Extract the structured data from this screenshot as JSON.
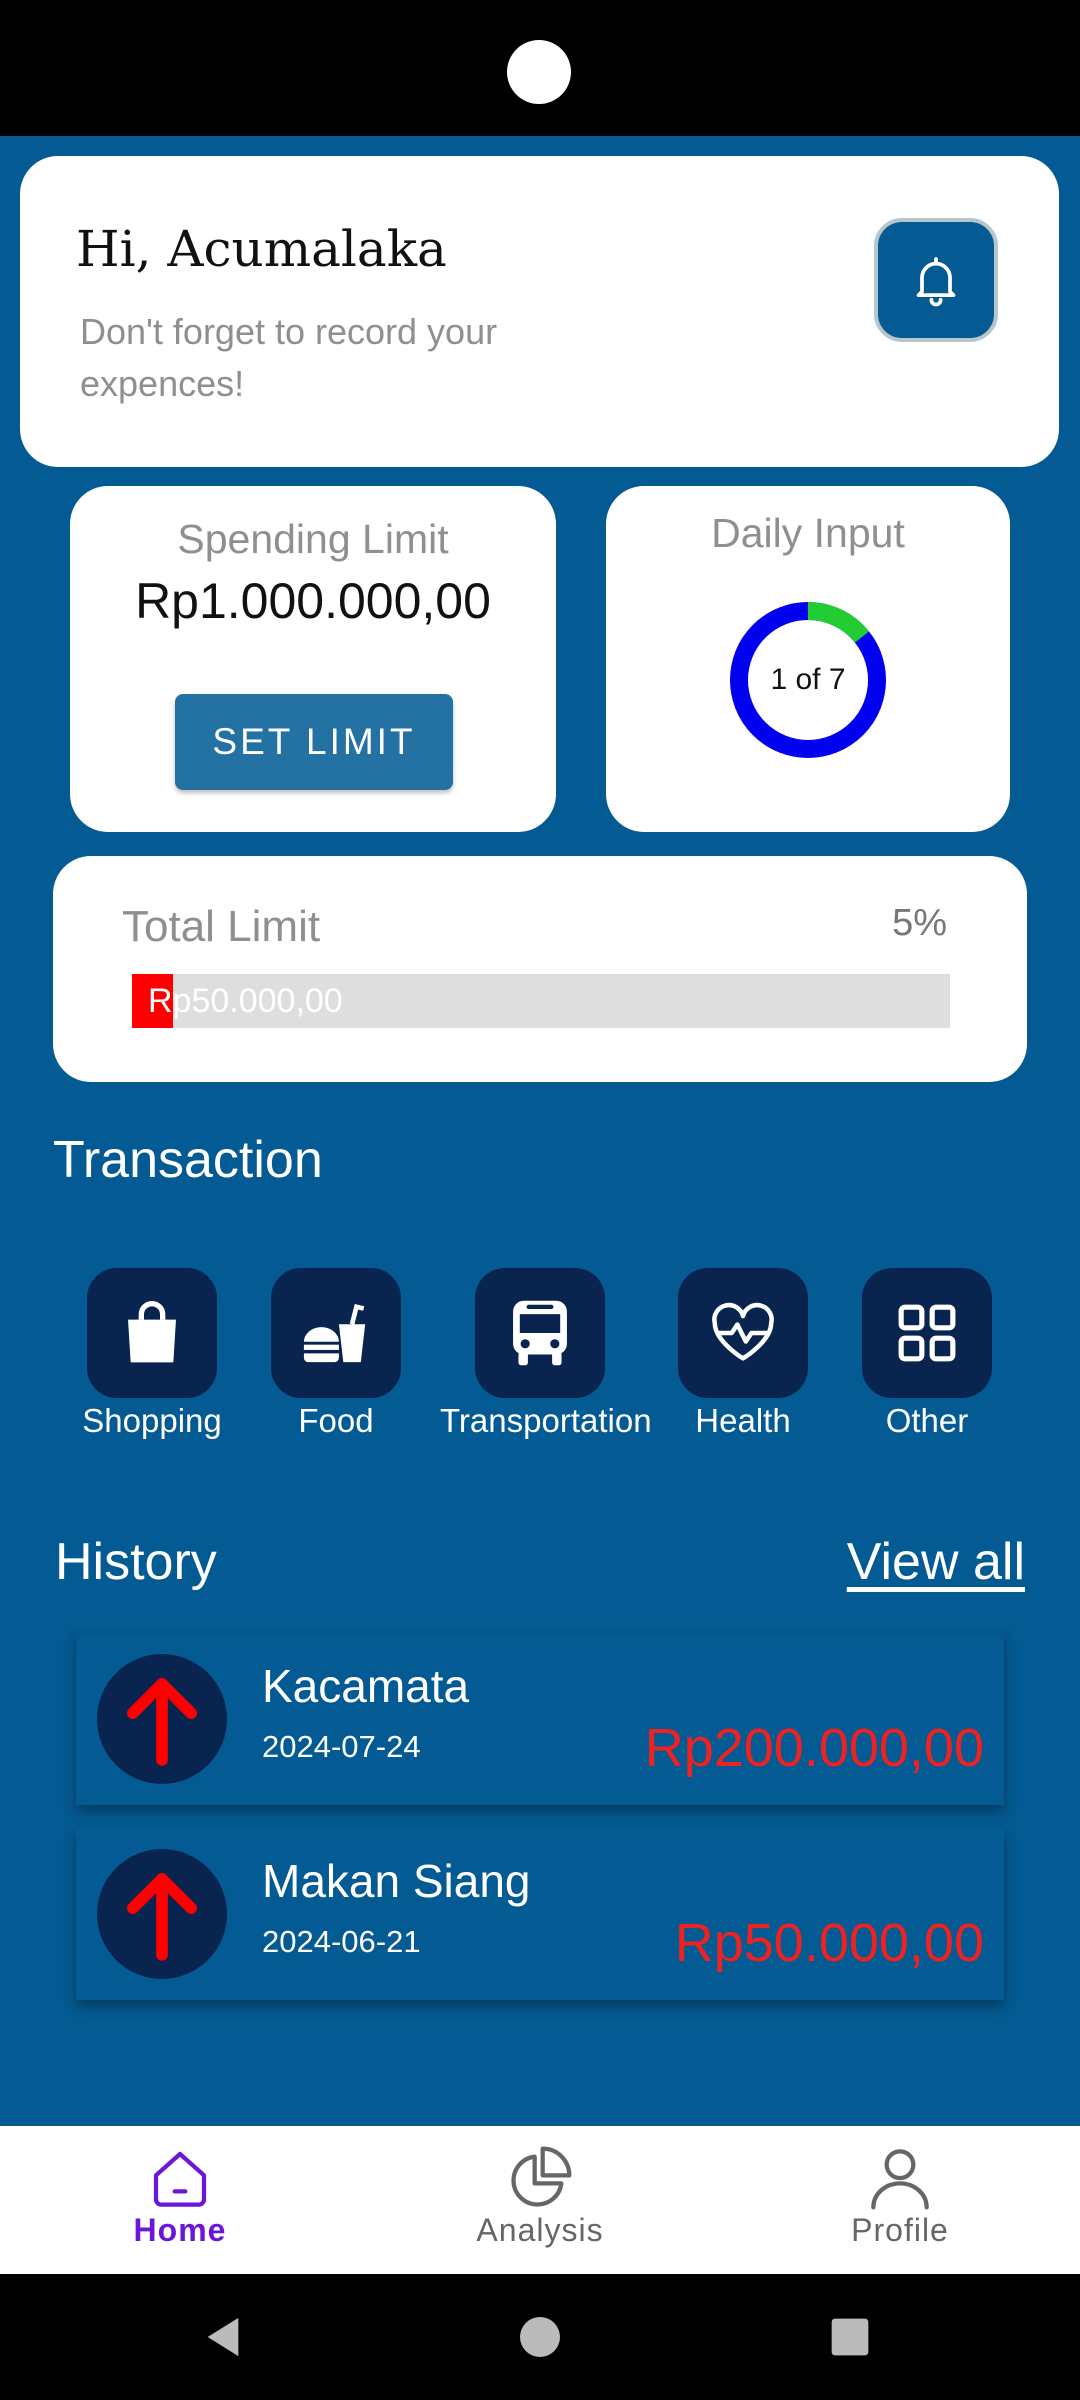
{
  "header": {
    "greeting": "Hi, Acumalaka",
    "subtitle": "Don't forget to record your  expences!",
    "notification_icon": "bell-icon"
  },
  "spending_limit": {
    "label": "Spending Limit",
    "value": "Rp1.000.000,00",
    "button_label": "SET LIMIT"
  },
  "daily_input": {
    "label": "Daily Input",
    "progress_text": "1 of 7",
    "completed": 1,
    "total": 7
  },
  "total_limit": {
    "label": "Total Limit",
    "percent_text": "5%",
    "percent_value": 5,
    "bar_text": "Rp50.000,00"
  },
  "transaction": {
    "title": "Transaction",
    "categories": [
      {
        "label": "Shopping",
        "icon": "shopping-bag-icon"
      },
      {
        "label": "Food",
        "icon": "fast-food-icon"
      },
      {
        "label": "Transportation",
        "icon": "bus-icon"
      },
      {
        "label": "Health",
        "icon": "heart-pulse-icon"
      },
      {
        "label": "Other",
        "icon": "grid-icon"
      }
    ]
  },
  "history": {
    "title": "History",
    "view_all": "View all",
    "items": [
      {
        "name": "Kacamata",
        "date": "2024-07-24",
        "amount": "Rp200.000,00",
        "icon": "arrow-up-icon"
      },
      {
        "name": "Makan Siang",
        "date": "2024-06-21",
        "amount": "Rp50.000,00",
        "icon": "arrow-up-icon"
      }
    ]
  },
  "bottom_nav": {
    "items": [
      {
        "label": "Home",
        "icon": "home-icon",
        "active": true
      },
      {
        "label": "Analysis",
        "icon": "pie-chart-icon",
        "active": false
      },
      {
        "label": "Profile",
        "icon": "person-icon",
        "active": false
      }
    ]
  },
  "system_nav": {
    "back_icon": "back-icon",
    "home_icon": "home-circle-icon",
    "recents_icon": "recents-icon"
  },
  "colors": {
    "background": "#045a92",
    "tile": "#0a2450",
    "accent_active": "#6b16d8",
    "expense": "#ee2222",
    "donut_done": "#22cc33",
    "donut_remaining": "#0000ee",
    "progress_fill": "#ff0000"
  }
}
